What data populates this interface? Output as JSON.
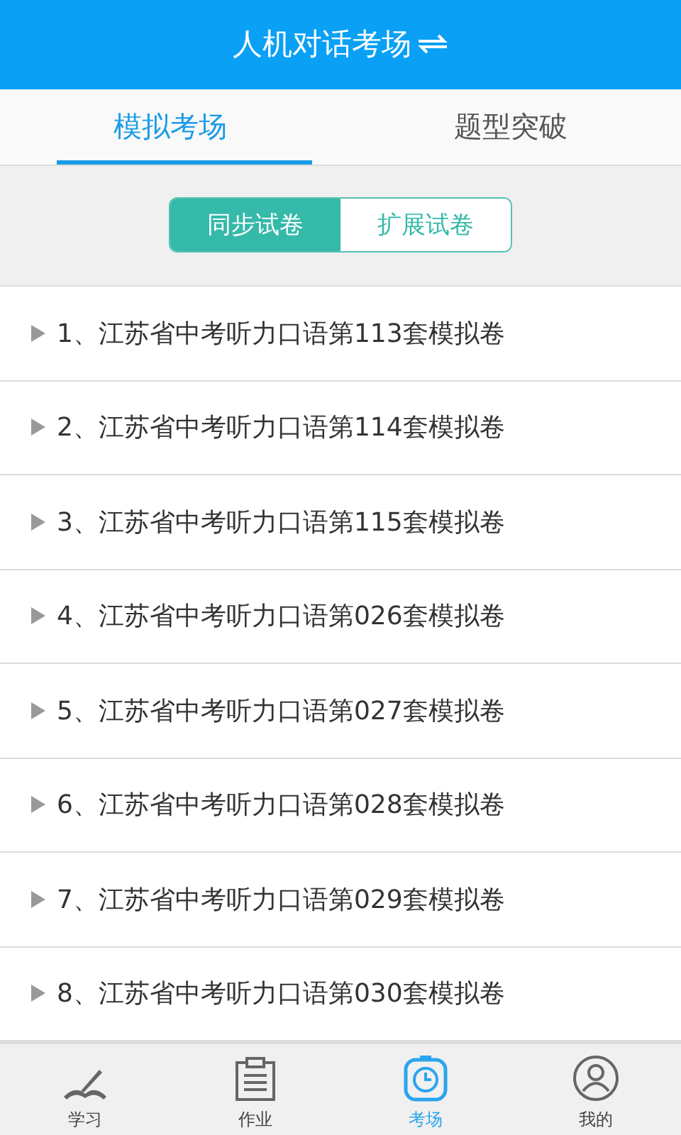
{
  "header": {
    "title": "人机对话考场"
  },
  "tabs": [
    {
      "label": "模拟考场",
      "selected": true
    },
    {
      "label": "题型突破",
      "selected": false
    }
  ],
  "segments": [
    {
      "label": "同步试卷",
      "selected": true
    },
    {
      "label": "扩展试卷",
      "selected": false
    }
  ],
  "papers": [
    "1、江苏省中考听力口语第113套模拟卷",
    "2、江苏省中考听力口语第114套模拟卷",
    "3、江苏省中考听力口语第115套模拟卷",
    "4、江苏省中考听力口语第026套模拟卷",
    "5、江苏省中考听力口语第027套模拟卷",
    "6、江苏省中考听力口语第028套模拟卷",
    "7、江苏省中考听力口语第029套模拟卷",
    "8、江苏省中考听力口语第030套模拟卷"
  ],
  "nav": [
    {
      "kind": "study",
      "label": "学习",
      "selected": false
    },
    {
      "kind": "homework",
      "label": "作业",
      "selected": false
    },
    {
      "kind": "exam",
      "label": "考场",
      "selected": true
    },
    {
      "kind": "profile",
      "label": "我的",
      "selected": false
    }
  ]
}
